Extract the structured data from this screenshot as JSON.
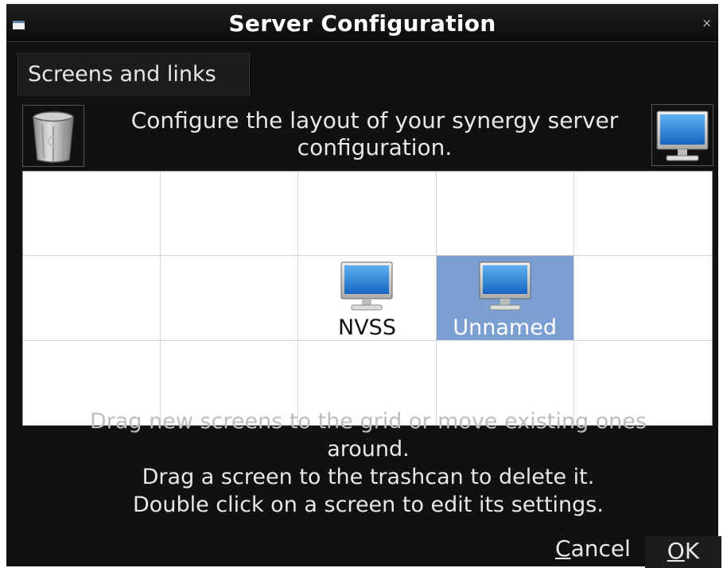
{
  "window": {
    "title": "Server Configuration",
    "close_glyph": "×"
  },
  "tabs": [
    {
      "label": "Screens and links",
      "active": true
    }
  ],
  "description": "Configure the layout of your synergy server configuration.",
  "icons": {
    "trash": "trashcan-icon",
    "new_screen": "monitor-icon"
  },
  "grid": {
    "rows": 3,
    "cols": 5,
    "screens": [
      {
        "name": "NVSS",
        "row": 1,
        "col": 2,
        "selected": false
      },
      {
        "name": "Unnamed",
        "row": 1,
        "col": 3,
        "selected": true
      }
    ]
  },
  "hints": {
    "line1": "Drag new screens to the grid or move existing ones",
    "line2": "around.",
    "line3": "Drag a screen to the trashcan to delete it.",
    "line4": "Double click on a screen to edit its settings."
  },
  "buttons": {
    "cancel_mnemonic": "C",
    "cancel_rest": "ancel",
    "ok_mnemonic": "O",
    "ok_rest": "K"
  },
  "colors": {
    "selection": "#7a9fd0",
    "background": "#111111"
  }
}
